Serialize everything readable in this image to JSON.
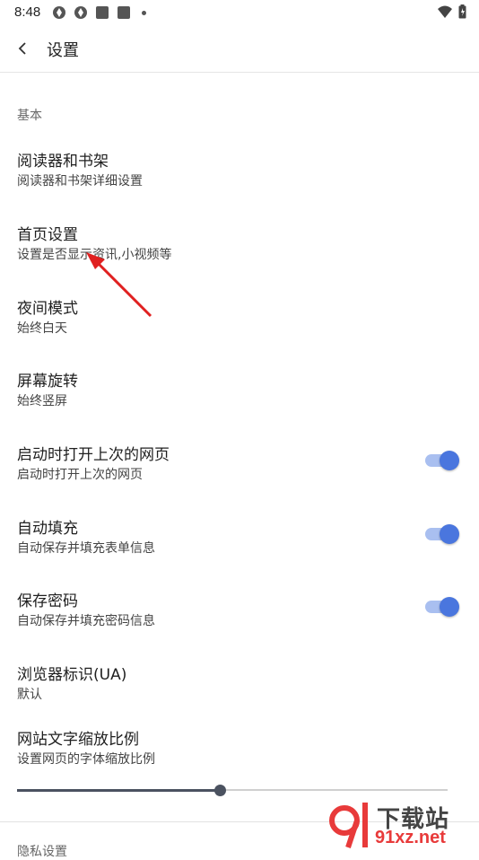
{
  "status": {
    "time": "8:48"
  },
  "header": {
    "title": "设置"
  },
  "sections": {
    "basic": "基本",
    "next": "隐私设置"
  },
  "items": [
    {
      "title": "阅读器和书架",
      "subtitle": "阅读器和书架详细设置"
    },
    {
      "title": "首页设置",
      "subtitle": "设置是否显示资讯,小视频等"
    },
    {
      "title": "夜间模式",
      "subtitle": "始终白天"
    },
    {
      "title": "屏幕旋转",
      "subtitle": "始终竖屏"
    },
    {
      "title": "启动时打开上次的网页",
      "subtitle": "启动时打开上次的网页",
      "toggle": true
    },
    {
      "title": "自动填充",
      "subtitle": "自动保存并填充表单信息",
      "toggle": true
    },
    {
      "title": "保存密码",
      "subtitle": "自动保存并填充密码信息",
      "toggle": true
    },
    {
      "title": "浏览器标识(UA)",
      "subtitle": "默认"
    },
    {
      "title": "网站文字缩放比例",
      "subtitle": "设置网页的字体缩放比例"
    }
  ],
  "font_scale_slider": {
    "value": 0.47
  },
  "colors": {
    "accent": "#4a76de",
    "annotation_arrow": "#e02020"
  },
  "watermark": {
    "brand": "下载站",
    "domain": "91xz.net"
  }
}
